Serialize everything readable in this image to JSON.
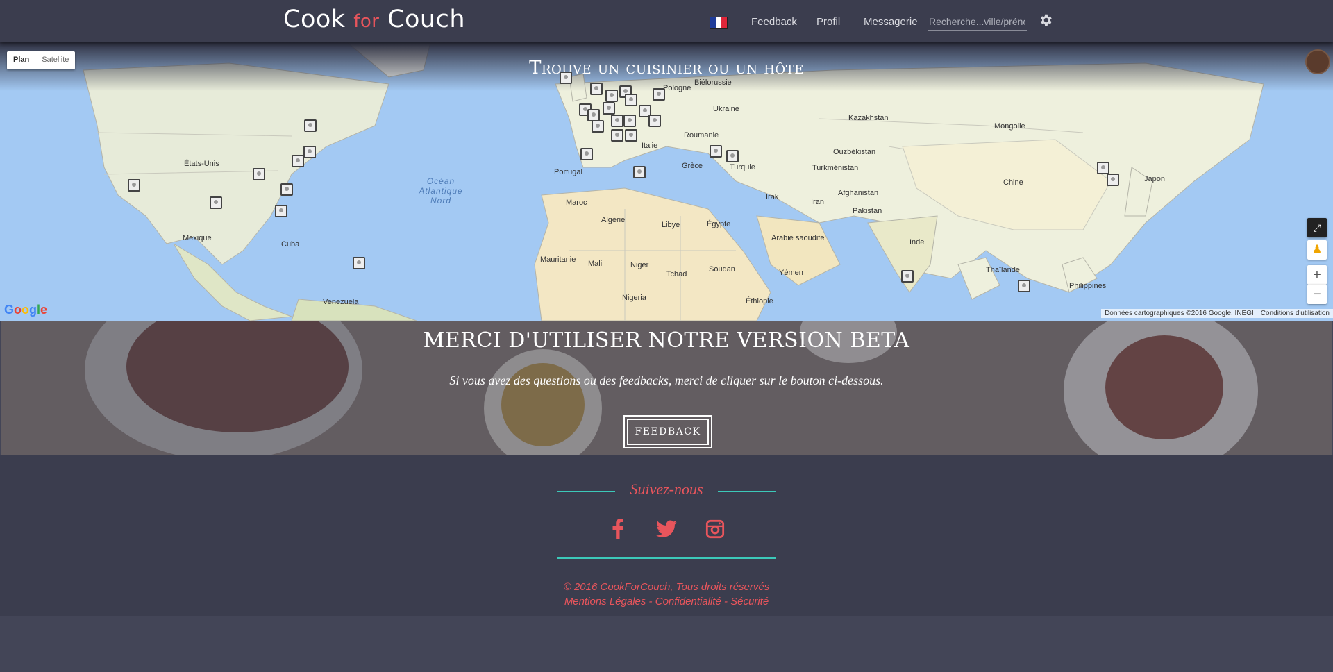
{
  "nav": {
    "brand_part1": "Cook",
    "brand_for": "for",
    "brand_part2": "Couch",
    "language_flag": "french-flag-icon",
    "links": [
      "Feedback",
      "Profil",
      "Messagerie"
    ],
    "search_placeholder": "Recherche...ville/prénom",
    "settings_icon": "gear-icon"
  },
  "map": {
    "title": "Trouve un cuisinier ou un hôte",
    "type_buttons": [
      "Plan",
      "Satellite"
    ],
    "active_type": "Plan",
    "labels": {
      "atlantic": "Océan Atlantique Nord",
      "usa": "États-Unis",
      "mexique": "Mexique",
      "venezuela": "Venezuela",
      "portugal": "Portugal",
      "maroc": "Maroc",
      "algerie": "Algérie",
      "libye": "Libye",
      "egypte": "Égypte",
      "mali": "Mali",
      "niger": "Niger",
      "tchad": "Tchad",
      "soudan": "Soudan",
      "nigeria": "Nigeria",
      "mauritanie": "Mauritanie",
      "italie": "Italie",
      "turquie": "Turquie",
      "ukraine": "Ukraine",
      "pologne": "Pologne",
      "bielorussie": "Biélorussie",
      "kazakhstan": "Kazakhstan",
      "mongolie": "Mongolie",
      "chine": "Chine",
      "japon": "Japon",
      "inde": "Inde",
      "iran": "Iran",
      "irak": "Irak",
      "arabie": "Arabie saoudite",
      "afghanistan": "Afghanistan",
      "pakistan": "Pakistan",
      "ouzbekistan": "Ouzbékistan",
      "turkmenistan": "Turkménistan",
      "thailande": "Thaïlande",
      "philippines": "Philippines",
      "yemen": "Yémen",
      "ethiopie": "Éthiopie",
      "cuba": "Cuba",
      "roumanie": "Roumanie",
      "grece": "Grèce"
    },
    "fullscreen_icon": "fullscreen-icon",
    "pegman_icon": "pegman-icon",
    "zoom_in": "+",
    "zoom_out": "−",
    "google_logo": "Google",
    "attribution": "Données cartographiques ©2016 Google, INEGI",
    "terms": "Conditions d'utilisation"
  },
  "beta": {
    "title": "MERCI D'UTILISER NOTRE VERSION BETA",
    "text": "Si vous avez des questions ou des feedbacks, merci de cliquer sur le bouton ci-dessous.",
    "button": "FEEDBACK"
  },
  "footer": {
    "follow": "Suivez-nous",
    "social_icons": [
      "facebook-icon",
      "twitter-icon",
      "instagram-icon"
    ],
    "copyright": "© 2016 CookForCouch, Tous droits réservés",
    "links": [
      "Mentions Légales",
      "Confidentialité",
      "Sécurité"
    ],
    "separator": " - "
  },
  "colors": {
    "navbar": "#3b3d4e",
    "accent_red": "#e8555c",
    "accent_teal": "#3cc9b9",
    "page_bg": "#434557"
  }
}
